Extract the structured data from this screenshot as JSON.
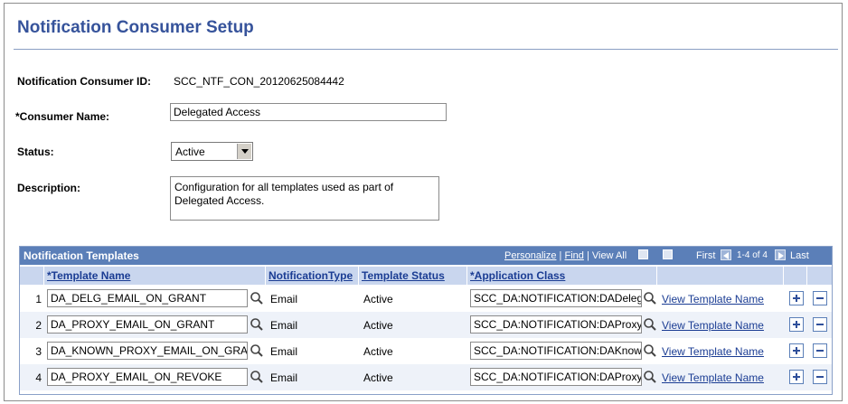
{
  "page": {
    "title": "Notification Consumer Setup"
  },
  "form": {
    "consumer_id_label": "Notification Consumer ID:",
    "consumer_id_value": "SCC_NTF_CON_20120625084442",
    "consumer_name_label": "*Consumer Name:",
    "consumer_name_value": "Delegated Access",
    "status_label": "Status:",
    "status_value": "Active",
    "description_label": "Description:",
    "description_line1": "Configuration for all templates used as part of",
    "description_line2": "Delegated Access."
  },
  "grid": {
    "title": "Notification Templates",
    "personalize": "Personalize",
    "find": "Find",
    "view_all": "View All",
    "sep": "|",
    "first": "First",
    "range": "1-4 of 4",
    "last": "Last",
    "columns": [
      "*Template Name",
      "NotificationType",
      "Template Status",
      "*Application Class"
    ],
    "rows": [
      {
        "num": "1",
        "template": "DA_DELG_EMAIL_ON_GRANT",
        "type": "Email",
        "status": "Active",
        "app_class": "SCC_DA:NOTIFICATION:DADeleg",
        "link": "View Template Name"
      },
      {
        "num": "2",
        "template": "DA_PROXY_EMAIL_ON_GRANT",
        "type": "Email",
        "status": "Active",
        "app_class": "SCC_DA:NOTIFICATION:DAProxy",
        "link": "View Template Name"
      },
      {
        "num": "3",
        "template": "DA_KNOWN_PROXY_EMAIL_ON_GRA",
        "type": "Email",
        "status": "Active",
        "app_class": "SCC_DA:NOTIFICATION:DAKnow",
        "link": "View Template Name"
      },
      {
        "num": "4",
        "template": "DA_PROXY_EMAIL_ON_REVOKE",
        "type": "Email",
        "status": "Active",
        "app_class": "SCC_DA:NOTIFICATION:DAProxy",
        "link": "View Template Name"
      }
    ]
  },
  "icons": {
    "lookup": "magnifier-icon",
    "add_row": "plus-icon",
    "delete_row": "minus-icon",
    "zoom": "zoom-icon",
    "download": "grid-download-icon"
  },
  "colors": {
    "title": "#36539b",
    "grid_header": "#5b7fb8",
    "column_header": "#c9d6ee",
    "link": "#1a3c93"
  }
}
